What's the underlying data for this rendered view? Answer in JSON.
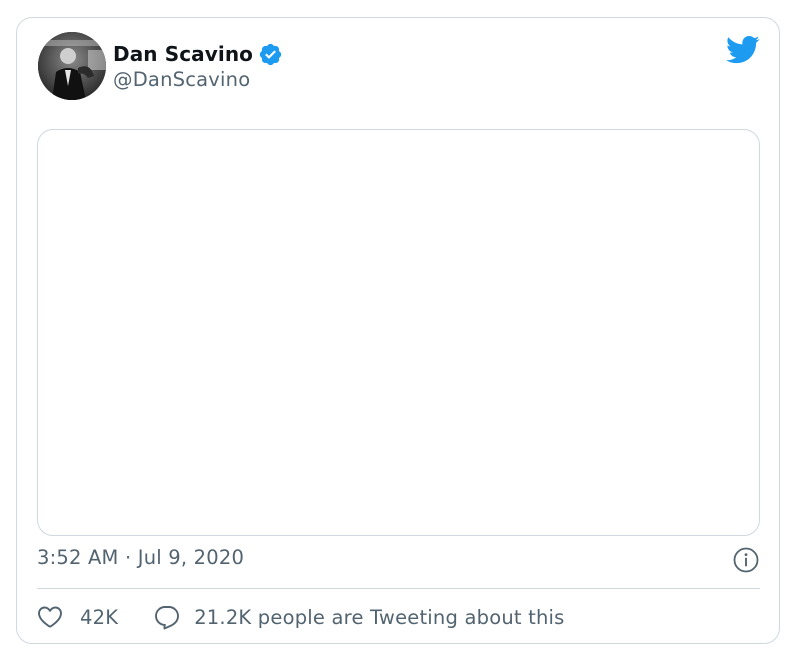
{
  "tweet": {
    "author": {
      "display_name": "Dan Scavino",
      "handle": "@DanScavino",
      "verified": true,
      "avatar": "profile-photo-icon"
    },
    "logo": "twitter-bird-icon",
    "media": {
      "content": ""
    },
    "timestamp": "3:52 AM · Jul 9, 2020",
    "info": "info-icon",
    "actions": {
      "like_count": "42K",
      "like_icon": "heart-icon",
      "reply_text": "21.2K people are Tweeting about this",
      "reply_icon": "comment-icon"
    }
  },
  "colors": {
    "text_primary": "#0f1419",
    "text_secondary": "#536471",
    "border": "#cfd9de",
    "accent": "#1d9bf0"
  }
}
